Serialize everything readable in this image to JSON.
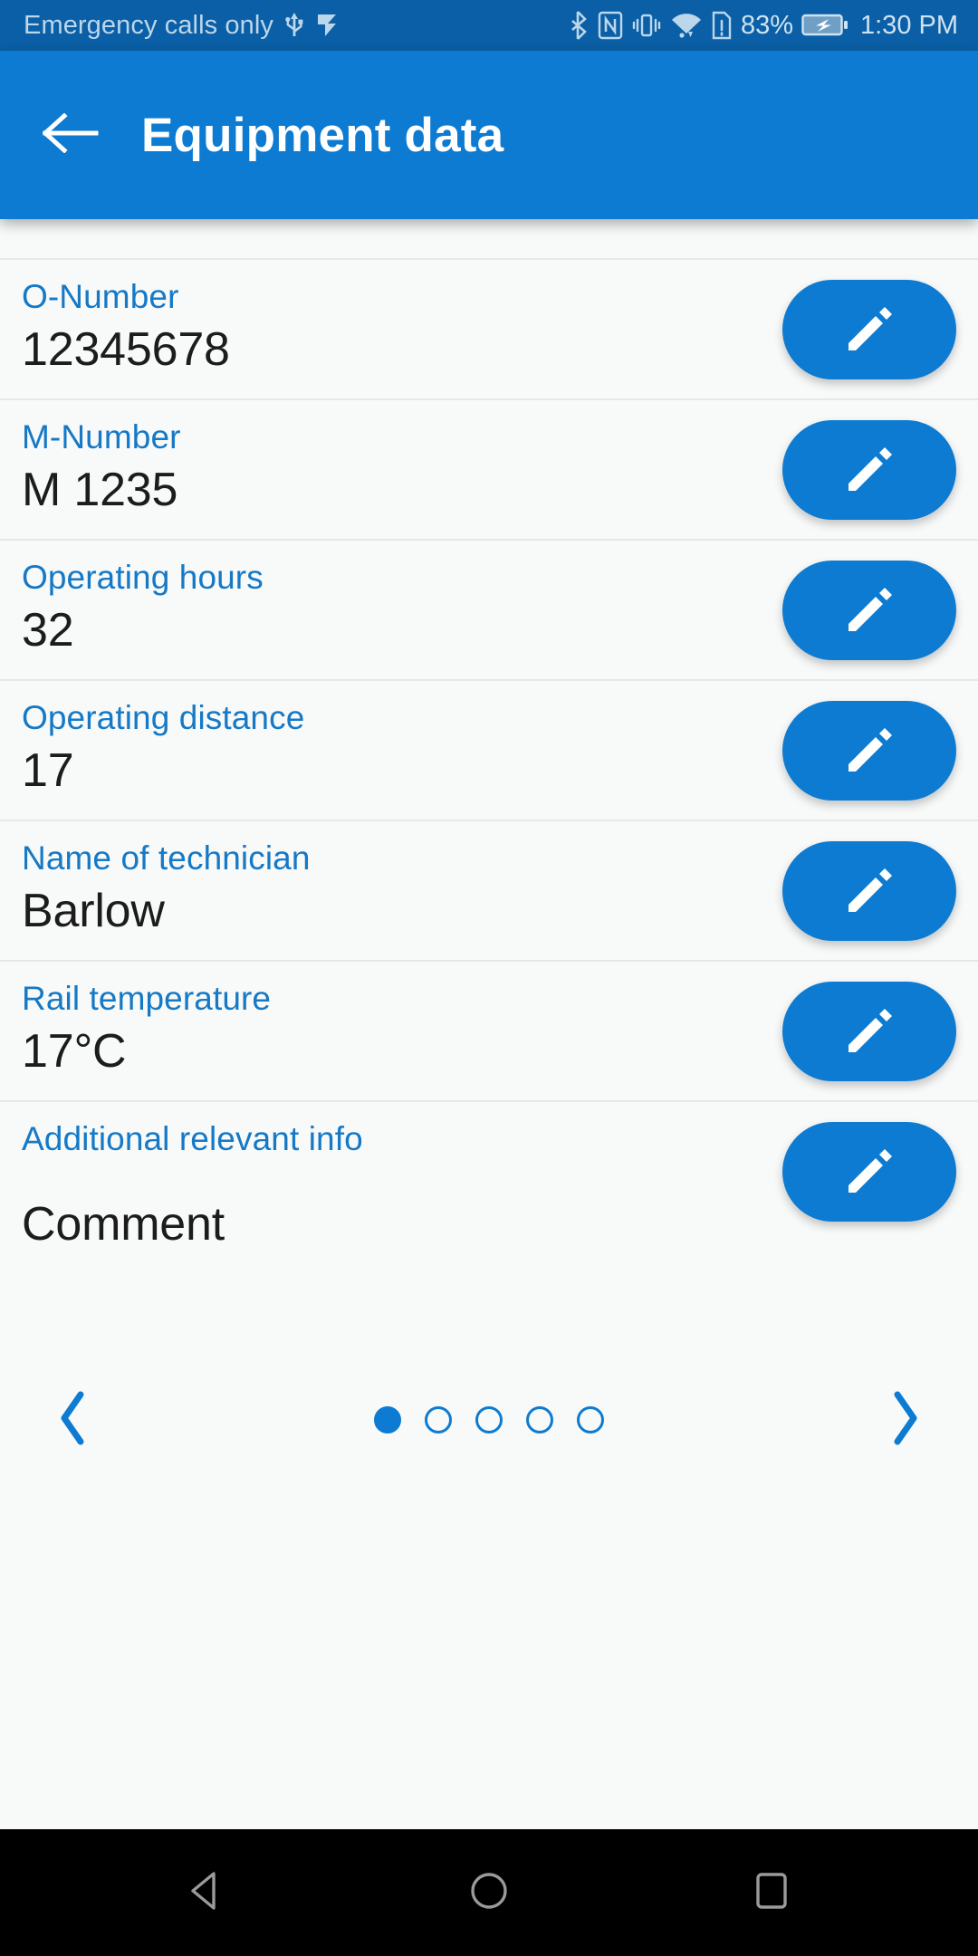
{
  "status_bar": {
    "carrier_text": "Emergency calls only",
    "left_icons": [
      "usb-icon",
      "flag-icon"
    ],
    "right_icons": [
      "bluetooth-icon",
      "nfc-icon",
      "vibrate-icon",
      "wifi-icon",
      "sim-alert-icon"
    ],
    "battery_percent": "83%",
    "battery_icon": "battery-charging-icon",
    "time": "1:30 PM"
  },
  "app_bar": {
    "back_icon": "arrow-left-icon",
    "title": "Equipment data"
  },
  "rows": [
    {
      "label": "O-Number",
      "value": "12345678",
      "edit_icon": "pencil-icon",
      "tall": false
    },
    {
      "label": "M-Number",
      "value": "M 1235",
      "edit_icon": "pencil-icon",
      "tall": false
    },
    {
      "label": "Operating hours",
      "value": "32",
      "edit_icon": "pencil-icon",
      "tall": false
    },
    {
      "label": "Operating distance",
      "value": "17",
      "edit_icon": "pencil-icon",
      "tall": false
    },
    {
      "label": "Name of technician",
      "value": "Barlow",
      "edit_icon": "pencil-icon",
      "tall": false
    },
    {
      "label": "Rail temperature",
      "value": "17°C",
      "edit_icon": "pencil-icon",
      "tall": false
    },
    {
      "label": "Additional relevant info",
      "value": "Comment",
      "edit_icon": "pencil-icon",
      "tall": true
    }
  ],
  "pagination": {
    "prev_icon": "chevron-left-icon",
    "next_icon": "chevron-right-icon",
    "total_pages": 5,
    "current_page": 1
  },
  "nav_bar": {
    "back_icon": "triangle-back-icon",
    "home_icon": "circle-home-icon",
    "recents_icon": "square-recents-icon"
  },
  "colors": {
    "status_bar_bg": "#0a5fa6",
    "app_bar_bg": "#0c7bd1",
    "accent": "#0c7bd1",
    "label_blue": "#1579c6",
    "content_bg": "#f8f9f9",
    "value_text": "#1c1c1c",
    "divider": "#e6e7e8",
    "nav_bar_bg": "#000000"
  }
}
